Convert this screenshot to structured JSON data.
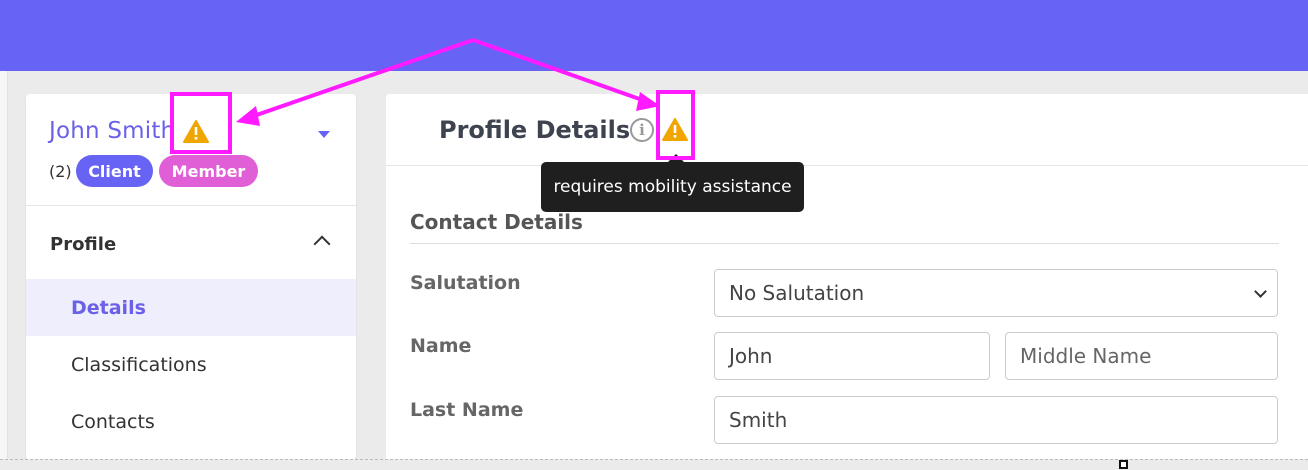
{
  "colors": {
    "topbar": "#6764f5",
    "accent": "#6a61e8",
    "member_badge": "#e05ed6",
    "warning": "#f0a500",
    "annotation": "#ff1aff"
  },
  "person": {
    "name": "John Smith",
    "count": "(2)",
    "badges": [
      "Client",
      "Member"
    ]
  },
  "sidebar": {
    "section_title": "Profile",
    "items": [
      {
        "label": "Details",
        "active": true
      },
      {
        "label": "Classifications"
      },
      {
        "label": "Contacts"
      }
    ]
  },
  "main": {
    "title": "Profile Details",
    "info_icon_glyph": "i",
    "tooltip": "requires mobility assistance",
    "contact_heading": "Contact Details",
    "fields": {
      "salutation": {
        "label": "Salutation",
        "value": "No Salutation"
      },
      "name": {
        "label": "Name",
        "first_value": "John",
        "middle_placeholder": "Middle Name"
      },
      "last_name": {
        "label": "Last Name",
        "value": "Smith"
      }
    }
  },
  "icons": {
    "warning": "warning-triangle-icon",
    "info": "info-icon",
    "collapse": "chevron-up-icon",
    "dropdown": "caret-down-icon"
  }
}
